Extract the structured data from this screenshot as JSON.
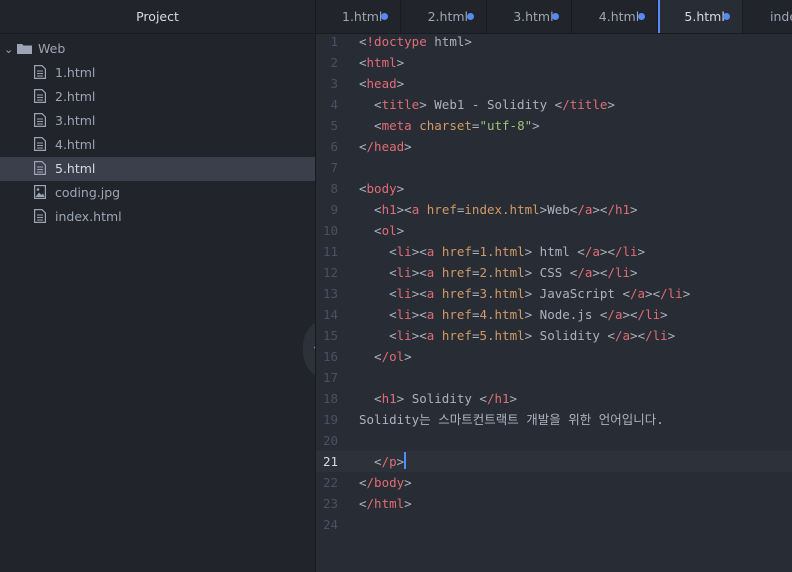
{
  "sidebar": {
    "title": "Project",
    "root_folder": "Web",
    "files": [
      {
        "name": "1.html",
        "icon": "file-text-icon",
        "selected": false
      },
      {
        "name": "2.html",
        "icon": "file-text-icon",
        "selected": false
      },
      {
        "name": "3.html",
        "icon": "file-text-icon",
        "selected": false
      },
      {
        "name": "4.html",
        "icon": "file-text-icon",
        "selected": false
      },
      {
        "name": "5.html",
        "icon": "file-text-icon",
        "selected": true
      },
      {
        "name": "coding.jpg",
        "icon": "image-file-icon",
        "selected": false
      },
      {
        "name": "index.html",
        "icon": "file-text-icon",
        "selected": false
      }
    ],
    "collapse_icon": "chevron-left-icon"
  },
  "tabs": [
    {
      "label": "1.html",
      "modified": true,
      "active": false
    },
    {
      "label": "2.html",
      "modified": true,
      "active": false
    },
    {
      "label": "3.html",
      "modified": true,
      "active": false
    },
    {
      "label": "4.html",
      "modified": true,
      "active": false
    },
    {
      "label": "5.html",
      "modified": true,
      "active": true
    },
    {
      "label": "index.h",
      "modified": false,
      "active": false
    }
  ],
  "editor": {
    "current_line": 21,
    "lines": [
      {
        "n": "1",
        "text": "<!doctype html>"
      },
      {
        "n": "2",
        "text": "<html>"
      },
      {
        "n": "3",
        "text": "<head>"
      },
      {
        "n": "4",
        "text": "  <title> Web1 - Solidity </title>"
      },
      {
        "n": "5",
        "text": "  <meta charset=\"utf-8\">"
      },
      {
        "n": "6",
        "text": "</head>"
      },
      {
        "n": "7",
        "text": ""
      },
      {
        "n": "8",
        "text": "<body>"
      },
      {
        "n": "9",
        "text": "  <h1><a href=index.html>Web</a></h1>"
      },
      {
        "n": "10",
        "text": "  <ol>"
      },
      {
        "n": "11",
        "text": "    <li><a href=1.html> html </a></li>"
      },
      {
        "n": "12",
        "text": "    <li><a href=2.html> CSS </a></li>"
      },
      {
        "n": "13",
        "text": "    <li><a href=3.html> JavaScript </a></li>"
      },
      {
        "n": "14",
        "text": "    <li><a href=4.html> Node.js </a></li>"
      },
      {
        "n": "15",
        "text": "    <li><a href=5.html> Solidity </a></li>"
      },
      {
        "n": "16",
        "text": "  </ol>"
      },
      {
        "n": "17",
        "text": ""
      },
      {
        "n": "18",
        "text": "  <h1> Solidity </h1>"
      },
      {
        "n": "19",
        "text": "Solidity는 스마트컨트랙트 개발을 위한 언어입니다."
      },
      {
        "n": "20",
        "text": ""
      },
      {
        "n": "21",
        "text": "  </p>"
      },
      {
        "n": "22",
        "text": "</body>"
      },
      {
        "n": "23",
        "text": "</html>"
      },
      {
        "n": "24",
        "text": ""
      }
    ]
  },
  "colors": {
    "tag": "#e06c75",
    "attribute": "#d19a66",
    "string": "#98c379",
    "text": "#abb2bf",
    "accent": "#568af2"
  }
}
